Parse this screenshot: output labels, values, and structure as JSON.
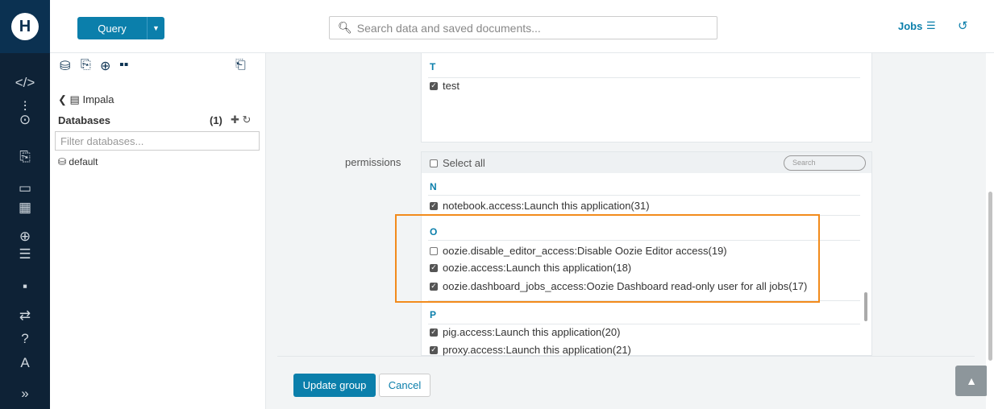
{
  "app": {
    "logo_icon": "hue-logo-icon"
  },
  "topbar": {
    "query_label": "Query",
    "search_placeholder": "Search data and saved documents...",
    "jobs_label": "Jobs"
  },
  "sidebar_icons": [
    "code-icon",
    "dashboard-icon",
    "scheduler-icon",
    "documents-icon",
    "folder-icon",
    "table-icon",
    "search-icon",
    "jobs-icon",
    "grid-icon",
    "transfer-icon",
    "help-icon",
    "user-icon",
    "expand-icon"
  ],
  "left_panel": {
    "back_label": "Impala",
    "databases_label": "Databases",
    "databases_count": "(1)",
    "filter_placeholder": "Filter databases...",
    "databases": [
      "default"
    ]
  },
  "group_form": {
    "t_section": {
      "letter": "T",
      "items": [
        {
          "label": "test",
          "checked": true
        }
      ]
    },
    "permissions_label": "permissions",
    "select_all_label": "Select all",
    "search_placeholder": "Search",
    "sections": [
      {
        "letter": "N",
        "items": [
          {
            "label": "notebook.access:Launch this application(31)",
            "checked": true
          }
        ]
      },
      {
        "letter": "O",
        "items": [
          {
            "label": "oozie.disable_editor_access:Disable Oozie Editor access(19)",
            "checked": false
          },
          {
            "label": "oozie.access:Launch this application(18)",
            "checked": true
          },
          {
            "label": "oozie.dashboard_jobs_access:Oozie Dashboard read-only user for all jobs(17)",
            "checked": true
          }
        ]
      },
      {
        "letter": "P",
        "items": [
          {
            "label": "pig.access:Launch this application(20)",
            "checked": true
          },
          {
            "label": "proxy.access:Launch this application(21)",
            "checked": true
          }
        ]
      }
    ],
    "update_label": "Update group",
    "cancel_label": "Cancel"
  },
  "colors": {
    "accent": "#0b7fab",
    "sidebar": "#0e2236",
    "highlight": "#f28b1c"
  }
}
